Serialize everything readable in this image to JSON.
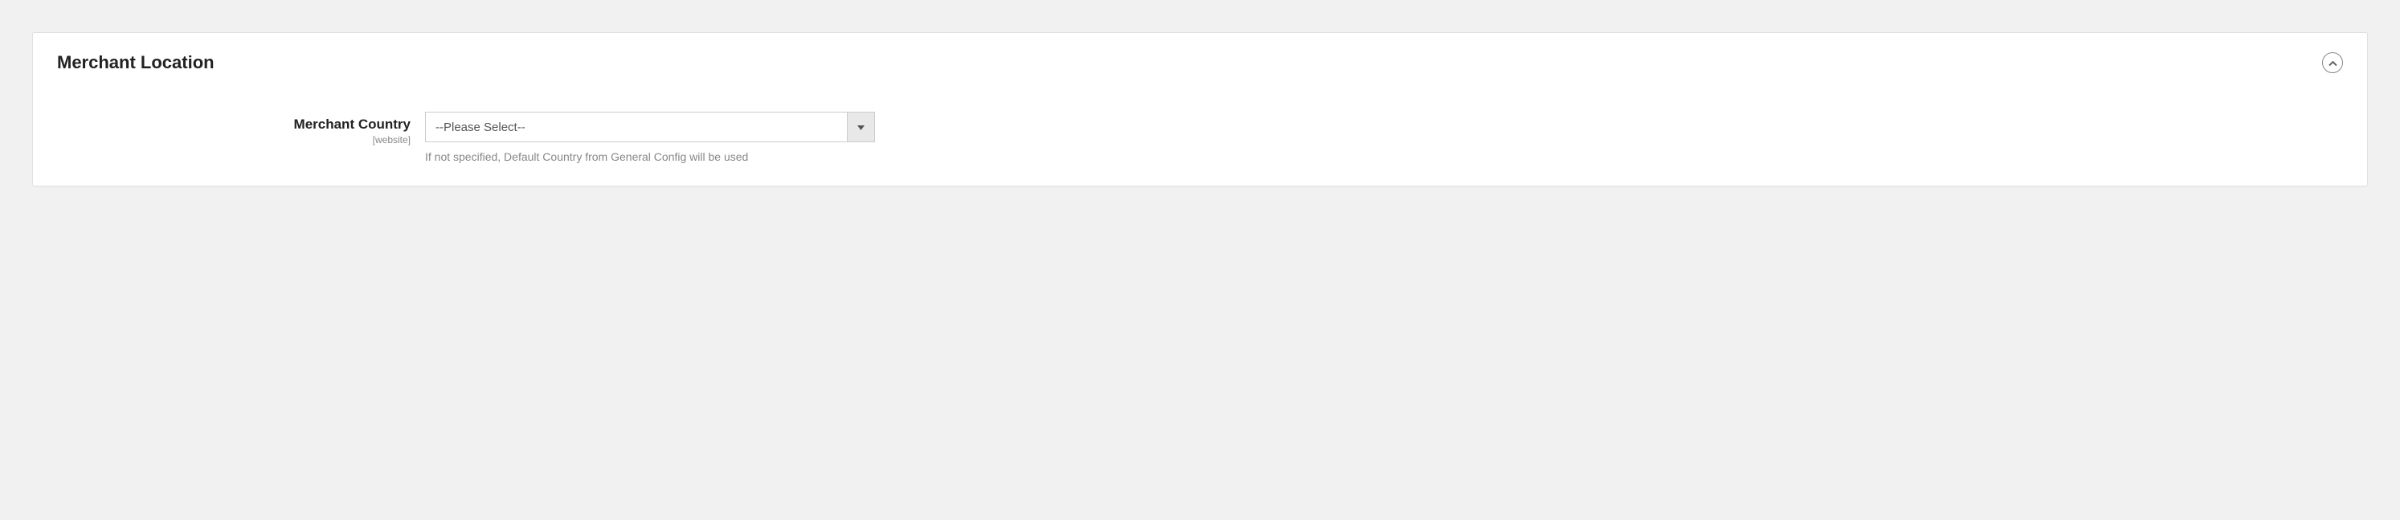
{
  "panel": {
    "title": "Merchant Location"
  },
  "form": {
    "merchant_country": {
      "label": "Merchant Country",
      "scope": "[website]",
      "selected": "--Please Select--",
      "help": "If not specified, Default Country from General Config will be used"
    }
  }
}
